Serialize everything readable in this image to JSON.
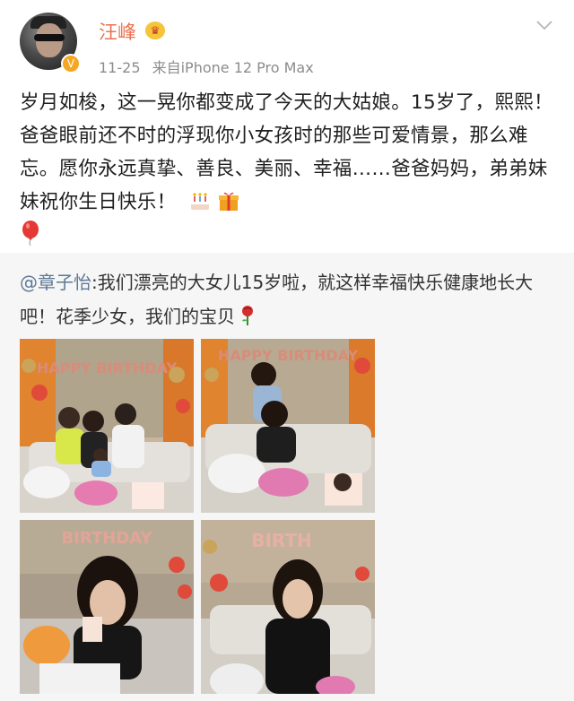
{
  "post": {
    "username": "汪峰",
    "date": "11-25",
    "source": "来自iPhone 12 Pro Max",
    "text": "岁月如梭，这一晃你都变成了今天的大姑娘。15岁了，熙熙！爸爸眼前还不时的浮现你小女孩时的那些可爱情景，那么难忘。愿你永远真挚、善良、美丽、幸福……爸爸妈妈，弟弟妹妹祝你生日快乐！",
    "emojis": [
      "cake-icon",
      "gift-icon",
      "balloon-icon"
    ]
  },
  "repost": {
    "mention": "@章子怡",
    "text": ":我们漂亮的大女儿15岁啦，就这样幸福快乐健康地长大吧！花季少女，我们的宝贝",
    "emoji": "rose-icon"
  },
  "photos": {
    "count": 4,
    "banner_1": "HAPPY BIRTHDAY",
    "banner_2": "HAPPY BIRTHDAY",
    "banner_3": "BIRTHDAY",
    "banner_4": "BIRTH"
  },
  "colors": {
    "username": "#eb7350",
    "mention": "#5d7895",
    "repost_bg": "#f6f6f6"
  }
}
